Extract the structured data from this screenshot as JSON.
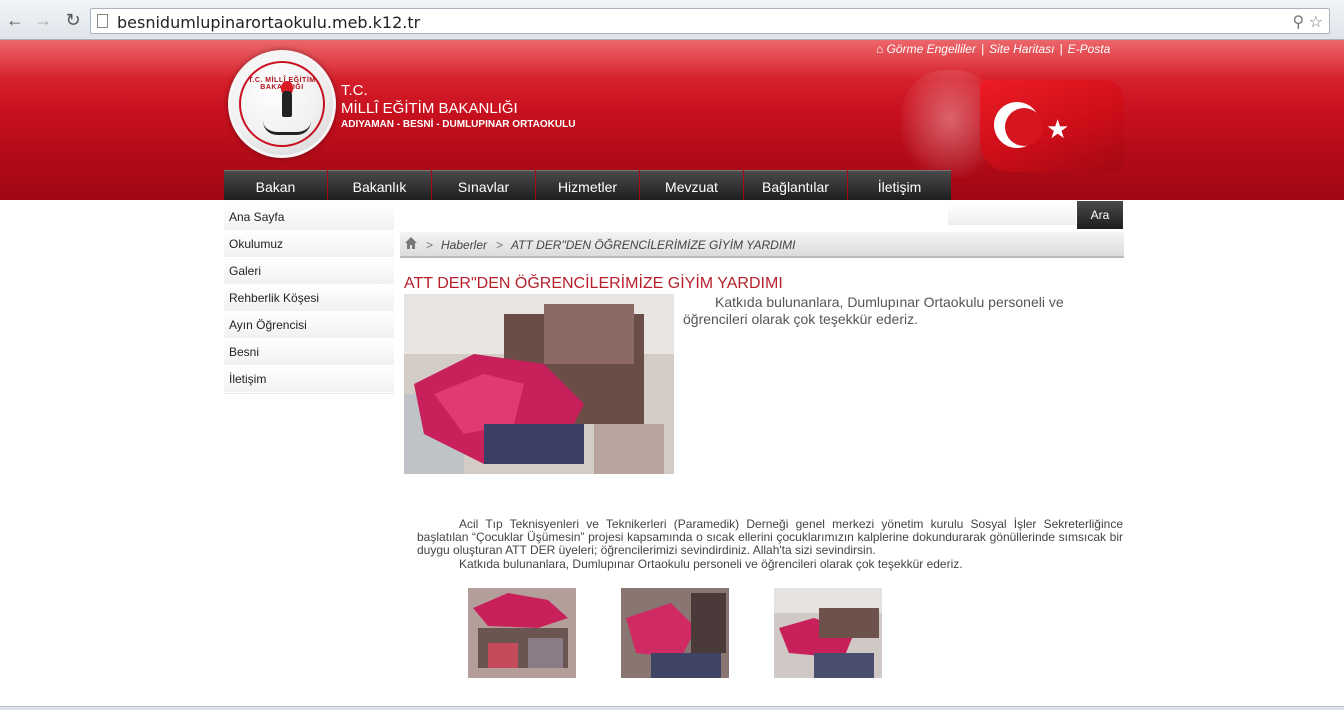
{
  "browser": {
    "url": "besnidumlupinarortaokulu.meb.k12.tr"
  },
  "header": {
    "toplinks": [
      "Görme Engelliler",
      "Site Haritası",
      "E-Posta"
    ],
    "title_tc": "T.C.",
    "title_main": "MİLLÎ EĞİTİM BAKANLIĞI",
    "title_sub": "ADIYAMAN - BESNİ - DUMLUPINAR ORTAOKULU",
    "logo_text": "T.C. MİLLÎ EĞİTİM BAKANLIĞI",
    "brand_red": "#c8101e"
  },
  "menu": [
    "Bakan",
    "Bakanlık",
    "Sınavlar",
    "Hizmetler",
    "Mevzuat",
    "Bağlantılar",
    "İletişim"
  ],
  "sidebar": [
    "Ana Sayfa",
    "Okulumuz",
    "Galeri",
    "Rehberlik Köşesi",
    "Ayın Öğrencisi",
    "Besni",
    "İletişim"
  ],
  "search": {
    "button": "Ara",
    "value": ""
  },
  "breadcrumb": {
    "section": "Haberler",
    "current": "ATT DER\"DEN ÖĞRENCİLERİMİZE GİYİM YARDIMI"
  },
  "article": {
    "title": "ATT DER\"DEN ÖĞRENCİLERİMİZE GİYİM YARDIMI",
    "intro": "Katkıda bulunanlara, Dumlupınar Ortaokulu personeli ve öğrencileri olarak çok teşekkür ederiz.",
    "paragraph1": "Acil Tıp Teknisyenleri ve Teknikerleri (Paramedik) Derneği genel merkezi yönetim kurulu Sosyal İşler Sekreterliğince başlatılan “Çocuklar Üşümesin” projesi kapsamında o sıcak ellerini çocuklarımızın kalplerine dokundurarak gönüllerinde sımsıcak bir duygu oluşturan ATT DER üyeleri; öğrencilerimizi sevindirdiniz. Allah'ta sizi sevindirsin.",
    "paragraph2": "Katkıda bulunanlara, Dumlupınar Ortaokulu personeli ve öğrencileri olarak çok teşekkür ederiz."
  }
}
